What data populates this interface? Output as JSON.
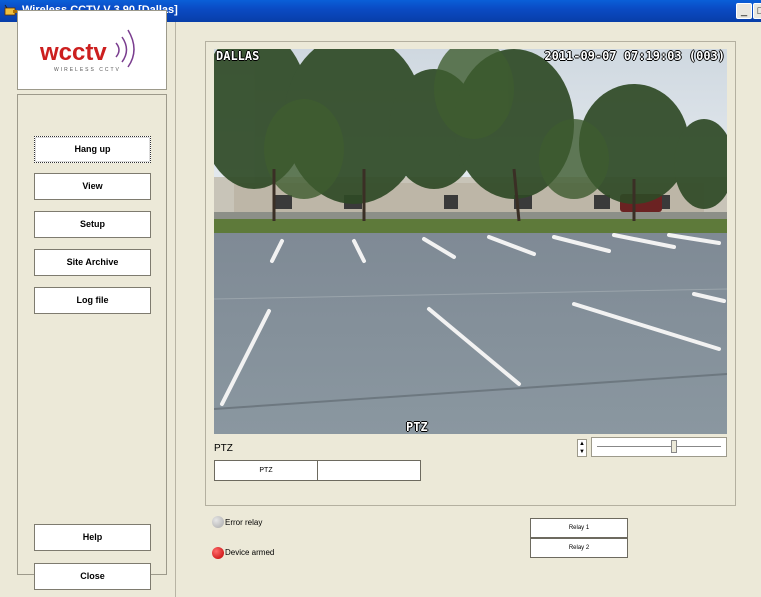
{
  "window": {
    "title": "Wireless CCTV   V 3.90  [Dallas]",
    "minimize_glyph": "_",
    "maximize_glyph": "□"
  },
  "logo": {
    "brand": "wcctv",
    "tagline": "WIRELESS CCTV"
  },
  "nav": {
    "top": [
      {
        "id": "hangup",
        "label": "Hang up"
      },
      {
        "id": "view",
        "label": "View"
      },
      {
        "id": "setup",
        "label": "Setup"
      },
      {
        "id": "site-archive",
        "label": "Site Archive"
      },
      {
        "id": "logfile",
        "label": "Log file"
      }
    ],
    "help_label": "Help",
    "close_label": "Close"
  },
  "video": {
    "site_overlay": "DALLAS",
    "timestamp_overlay": "2011-09-07 07:19:03 (003)",
    "ptz_overlay": "PTZ"
  },
  "ptz": {
    "label": "PTZ",
    "tabs": [
      "PTZ",
      ""
    ],
    "slider_level": 0.62,
    "spin_up": "▲",
    "spin_down": "▼"
  },
  "indicators": {
    "error_relay": {
      "label": "Error relay",
      "color": "#a9a9a9"
    },
    "device_armed": {
      "label": "Device armed",
      "color": "#c00000"
    }
  },
  "relays": [
    "Relay 1",
    "Relay 2"
  ],
  "colors": {
    "titlebar": "#0a4bc4",
    "logo_red": "#cc1f1f",
    "logo_purple": "#7a3d8f"
  }
}
